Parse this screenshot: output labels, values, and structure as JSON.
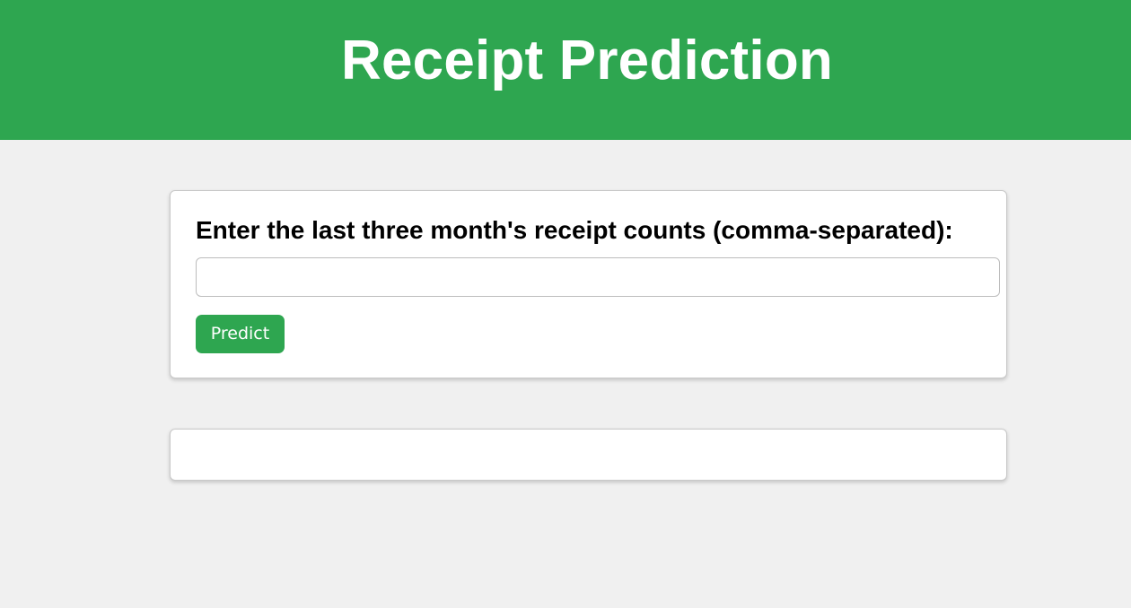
{
  "header": {
    "title": "Receipt Prediction"
  },
  "form": {
    "label": "Enter the last three month's receipt counts (comma-separated):",
    "input_value": "",
    "input_placeholder": "",
    "submit_label": "Predict"
  },
  "result": {
    "text": ""
  },
  "colors": {
    "brand_green": "#2ea650",
    "page_background": "#f0f0f0",
    "card_background": "#ffffff"
  }
}
